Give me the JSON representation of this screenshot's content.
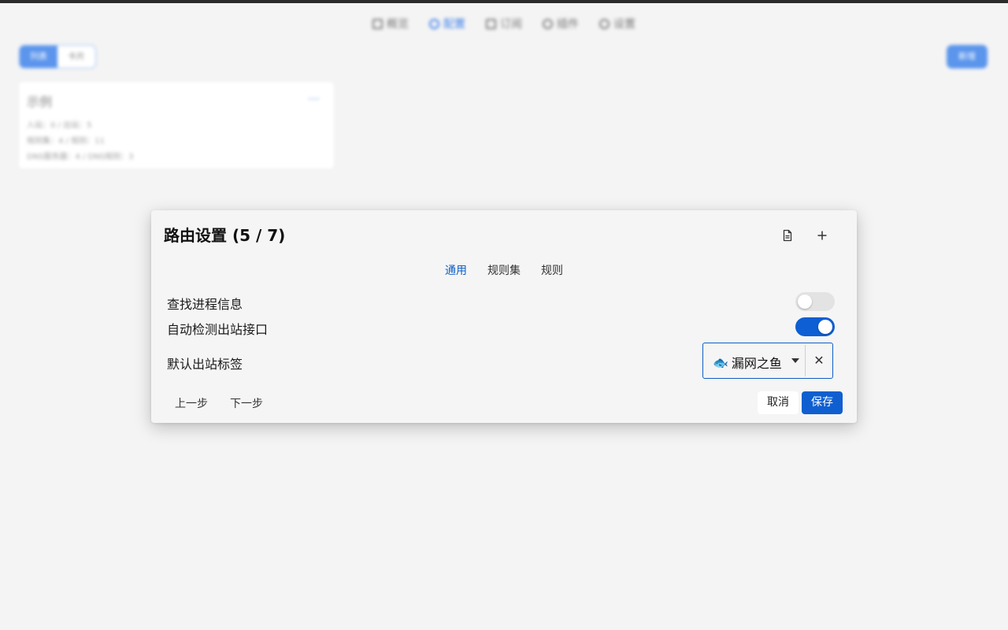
{
  "background": {
    "nav": [
      {
        "label": "概览",
        "icon": "grid-icon"
      },
      {
        "label": "配置",
        "icon": "network-icon",
        "active": true
      },
      {
        "label": "订阅",
        "icon": "list-icon"
      },
      {
        "label": "插件",
        "icon": "plugin-icon"
      },
      {
        "label": "设置",
        "icon": "settings-icon"
      }
    ],
    "segment": [
      "列表",
      "卡片"
    ],
    "new_button": "新增",
    "card": {
      "title": "示例",
      "more": "···",
      "lines": [
        "入站：0 / 出站：5",
        "规则集：4 / 规则：11",
        "DNS服务器：4 / DNS规则：3"
      ]
    }
  },
  "dialog": {
    "title": "路由设置 (5 / 7)",
    "icons": {
      "doc": "document-icon",
      "add": "plus-icon"
    },
    "tabs": [
      "通用",
      "规则集",
      "规则"
    ],
    "active_tab": "通用",
    "rows": {
      "find_process": "查找进程信息",
      "auto_detect": "自动检测出站接口",
      "default_outbound": "默认出站标签"
    },
    "find_process_enabled": false,
    "auto_detect_enabled": true,
    "default_outbound_value": "漏网之鱼",
    "default_outbound_emoji": "🐟",
    "prev_label": "上一步",
    "next_label": "下一步",
    "cancel_label": "取消",
    "save_label": "保存"
  },
  "colors": {
    "accent": "#0f5fd0",
    "background": "#f4f4f4"
  }
}
